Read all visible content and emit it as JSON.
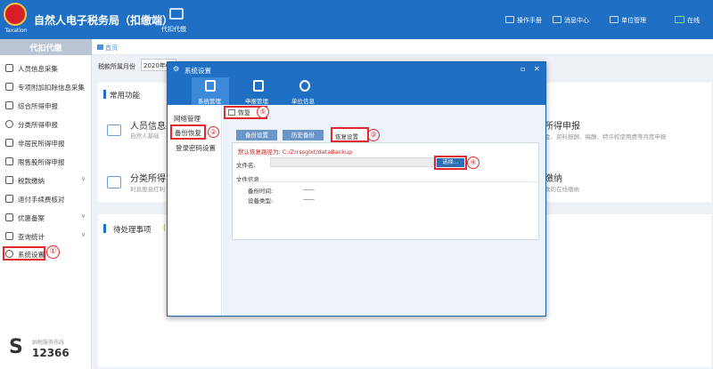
{
  "header": {
    "emblem_text": "Taxation",
    "title": "自然人电子税务局（扣缴端）",
    "agent_label": "代扣代缴",
    "actions": [
      {
        "label": "操作手册",
        "icon": "manual-icon"
      },
      {
        "label": "消息中心",
        "icon": "mail-icon"
      },
      {
        "label": "单位管理",
        "icon": "monitor-icon"
      },
      {
        "label": "在线",
        "icon": "online-icon"
      }
    ]
  },
  "sidebar": {
    "title": "代扣代缴",
    "items": [
      {
        "label": "人员信息采集",
        "icon": "person-icon"
      },
      {
        "label": "专项附加扣除信息采集",
        "icon": "list-icon"
      },
      {
        "label": "综合所得申报",
        "icon": "document-icon"
      },
      {
        "label": "分类所得申报",
        "icon": "pie-icon"
      },
      {
        "label": "非居民所得申报",
        "icon": "person-icon"
      },
      {
        "label": "限售股所得申报",
        "icon": "stock-icon"
      },
      {
        "label": "税款缴纳",
        "icon": "wallet-icon",
        "chevron": "∨"
      },
      {
        "label": "退付手续费核对",
        "icon": "check-icon"
      },
      {
        "label": "优惠备案",
        "icon": "discount-icon",
        "chevron": "∨"
      },
      {
        "label": "查询统计",
        "icon": "chart-icon",
        "chevron": "∨"
      },
      {
        "label": "系统设置",
        "icon": "gear-icon"
      }
    ],
    "hotline_sub": "纳税服务热线",
    "hotline": "12366"
  },
  "breadcrumb": {
    "home": "首页"
  },
  "filter": {
    "label": "税款所属月份",
    "value": "2020年0"
  },
  "common": {
    "title": "常用功能",
    "cards": [
      {
        "title": "人员信息采",
        "sub": "自然人基础"
      },
      {
        "title": "分类所得申",
        "sub": "利息股息红利"
      },
      {
        "title": "所得申报",
        "sub": "金、资料报酬、稿酬、特许权使用费等月度申报"
      },
      {
        "title": "缴纳",
        "sub": "款的在线缴纳"
      }
    ]
  },
  "pending": {
    "title": "待处理事项",
    "extra": "("
  },
  "dialog": {
    "title": "系统设置",
    "window_controls": [
      "▫",
      "✕"
    ],
    "tabs": [
      {
        "label": "系统管理"
      },
      {
        "label": "申报管理"
      },
      {
        "label": "单位信息"
      }
    ],
    "nav": [
      "网络管理",
      "备份恢复",
      "登录密码设置"
    ],
    "restore_button": "恢复",
    "sub_tabs": [
      "备份设置",
      "历史备份",
      "恢复设置"
    ],
    "default_path": "默认恢复路径为: C:/Zrrssglxt/dataBackup",
    "file_label": "文件名:",
    "file_value": "",
    "choose_button": "选择...",
    "info_label": "文件信息",
    "backup_time_label": "备份时间:",
    "backup_time_value": "——",
    "device_type_label": "设备类型:",
    "device_type_value": "——"
  },
  "markers": [
    "①",
    "②",
    "③",
    "④",
    "⑤"
  ],
  "colors": {
    "brand": "#1f6fc4",
    "highlight": "#e0282e"
  }
}
